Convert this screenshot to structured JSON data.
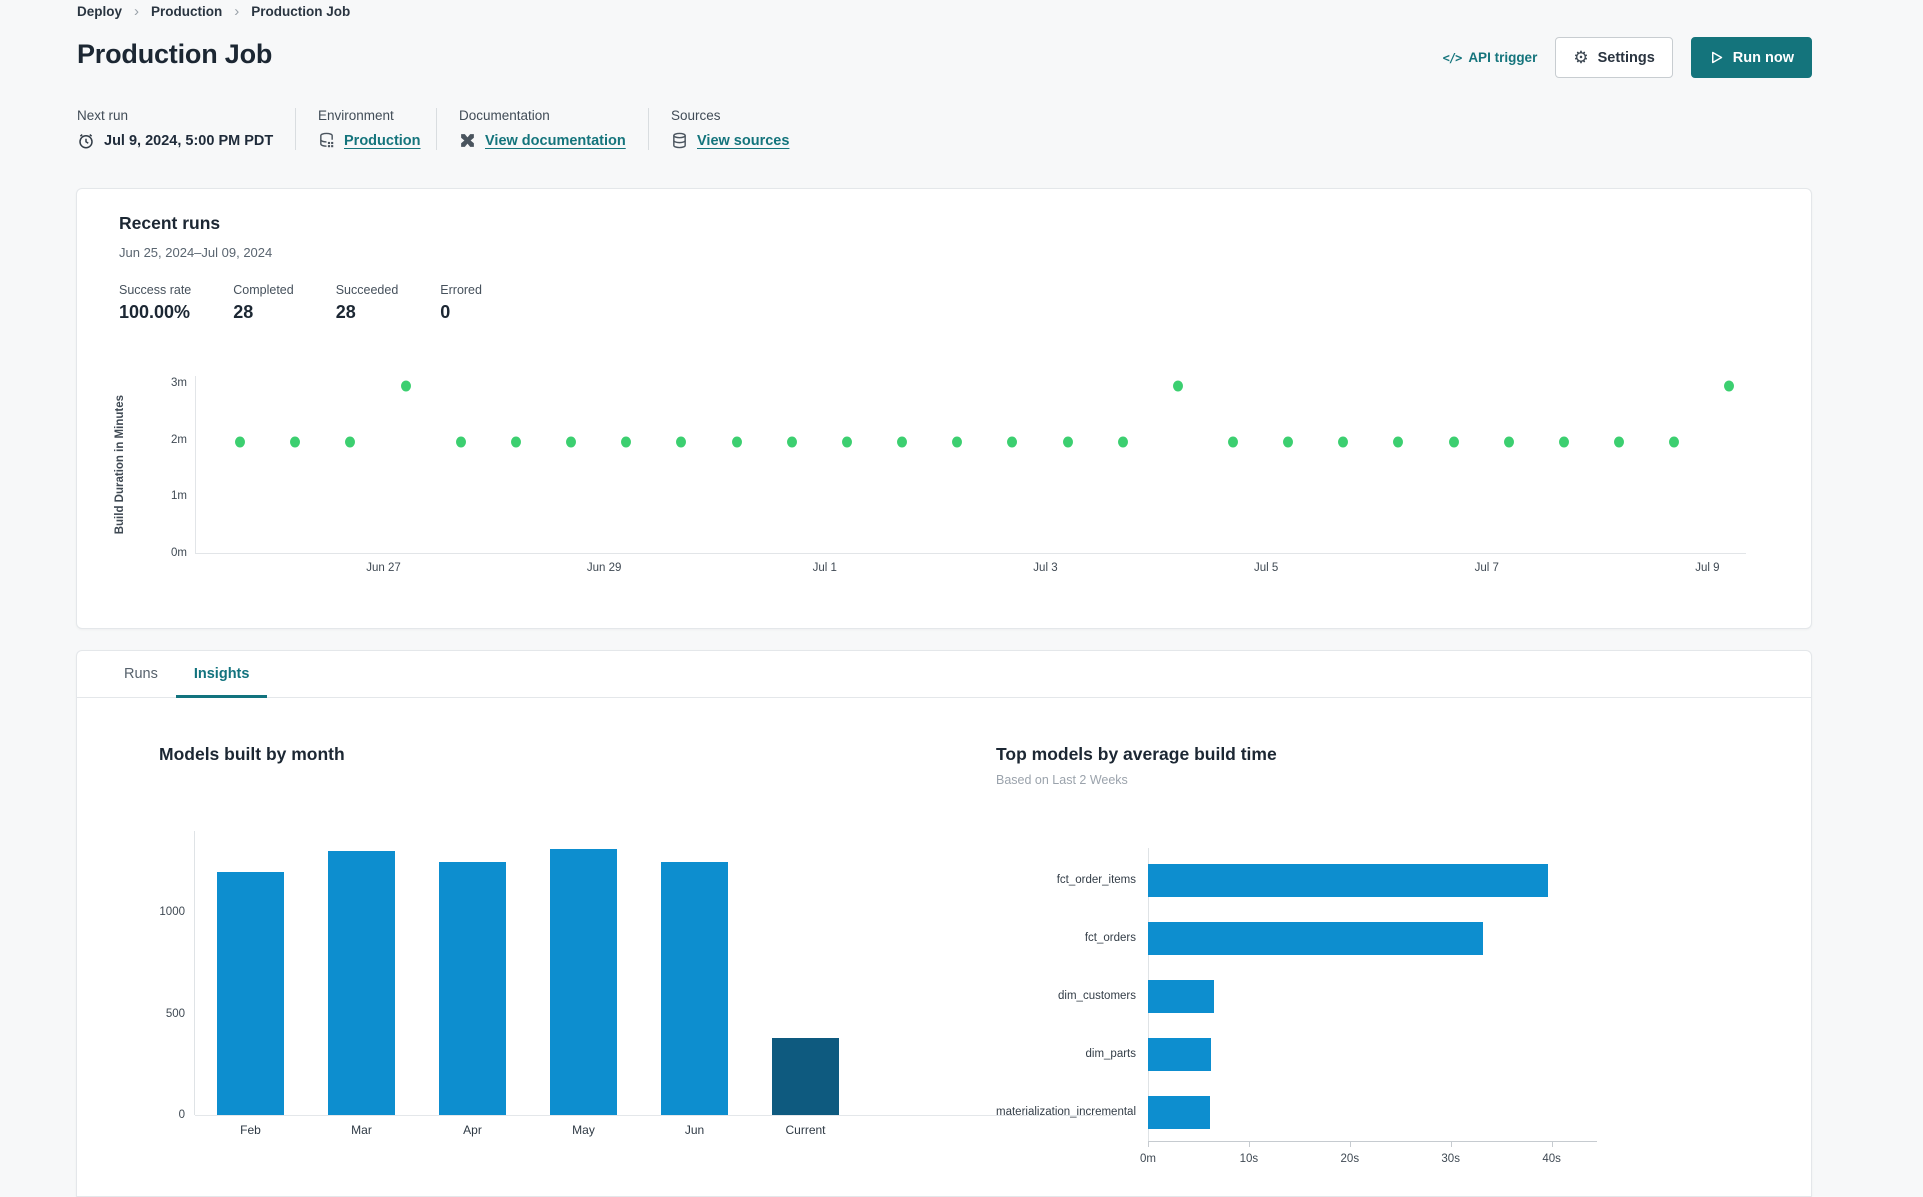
{
  "breadcrumb": {
    "items": [
      "Deploy",
      "Production",
      "Production Job"
    ]
  },
  "header": {
    "title": "Production Job",
    "api_trigger_label": "API trigger",
    "settings_label": "Settings",
    "run_now_label": "Run now"
  },
  "info": {
    "next_run": {
      "label": "Next run",
      "value": "Jul 9, 2024, 5:00 PM PDT"
    },
    "environment": {
      "label": "Environment",
      "link": "Production"
    },
    "documentation": {
      "label": "Documentation",
      "link": "View documentation"
    },
    "sources": {
      "label": "Sources",
      "link": "View sources"
    }
  },
  "recent_runs": {
    "title": "Recent runs",
    "date_range": "Jun 25, 2024–Jul 09, 2024",
    "stats": [
      {
        "label": "Success rate",
        "value": "100.00%"
      },
      {
        "label": "Completed",
        "value": "28"
      },
      {
        "label": "Succeeded",
        "value": "28"
      },
      {
        "label": "Errored",
        "value": "0"
      }
    ]
  },
  "tabs": [
    {
      "label": "Runs",
      "active": false
    },
    {
      "label": "Insights",
      "active": true
    }
  ],
  "colors": {
    "accent_teal": "#14747c",
    "bar_blue": "#0d8ecf",
    "bar_dark_blue": "#0e5a7f",
    "dot_green": "#3ccf70"
  },
  "chart_data": [
    {
      "id": "run-durations",
      "type": "scatter",
      "ylabel": "Build Duration in Minutes",
      "x_range": [
        -0.4,
        13.65
      ],
      "y_range": [
        0,
        3.12
      ],
      "y_ticks": [
        {
          "label": "3m",
          "minutes": 3
        },
        {
          "label": "2m",
          "minutes": 2
        },
        {
          "label": "1m",
          "minutes": 1
        },
        {
          "label": "0m",
          "minutes": 0
        }
      ],
      "x_ticks": [
        {
          "label": "Jun 27",
          "day": 1.3
        },
        {
          "label": "Jun 29",
          "day": 3.3
        },
        {
          "label": "Jul 1",
          "day": 5.3
        },
        {
          "label": "Jul 3",
          "day": 7.3
        },
        {
          "label": "Jul 5",
          "day": 9.3
        },
        {
          "label": "Jul 7",
          "day": 11.3
        },
        {
          "label": "Jul 9",
          "day": 13.3
        }
      ],
      "point_color": "#3ccf70",
      "points": [
        {
          "day": 0.0,
          "minutes": 1.95
        },
        {
          "day": 0.5,
          "minutes": 1.95
        },
        {
          "day": 1.0,
          "minutes": 1.95
        },
        {
          "day": 1.5,
          "minutes": 2.95
        },
        {
          "day": 2.0,
          "minutes": 1.95
        },
        {
          "day": 2.5,
          "minutes": 1.95
        },
        {
          "day": 3.0,
          "minutes": 1.95
        },
        {
          "day": 3.5,
          "minutes": 1.95
        },
        {
          "day": 4.0,
          "minutes": 1.95
        },
        {
          "day": 4.5,
          "minutes": 1.95
        },
        {
          "day": 5.0,
          "minutes": 1.95
        },
        {
          "day": 5.5,
          "minutes": 1.95
        },
        {
          "day": 6.0,
          "minutes": 1.95
        },
        {
          "day": 6.5,
          "minutes": 1.95
        },
        {
          "day": 7.0,
          "minutes": 1.95
        },
        {
          "day": 7.5,
          "minutes": 1.95
        },
        {
          "day": 8.0,
          "minutes": 1.95
        },
        {
          "day": 8.5,
          "minutes": 2.95
        },
        {
          "day": 9.0,
          "minutes": 1.95
        },
        {
          "day": 9.5,
          "minutes": 1.95
        },
        {
          "day": 10.0,
          "minutes": 1.95
        },
        {
          "day": 10.5,
          "minutes": 1.95
        },
        {
          "day": 11.0,
          "minutes": 1.95
        },
        {
          "day": 11.5,
          "minutes": 1.95
        },
        {
          "day": 12.0,
          "minutes": 1.95
        },
        {
          "day": 12.5,
          "minutes": 1.95
        },
        {
          "day": 13.0,
          "minutes": 1.95
        },
        {
          "day": 13.5,
          "minutes": 2.95
        }
      ]
    },
    {
      "id": "models-by-month",
      "type": "bar",
      "title": "Models built by month",
      "categories": [
        "Feb",
        "Mar",
        "Apr",
        "May",
        "Jun",
        "Current"
      ],
      "values": [
        1200,
        1300,
        1245,
        1310,
        1245,
        380
      ],
      "y_ticks": [
        0,
        500,
        1000
      ],
      "ylim": [
        0,
        1400
      ],
      "bar_color": "#0d8ecf",
      "current_bar_color": "#0e5a7f"
    },
    {
      "id": "top-models-by-build-time",
      "type": "bar-horizontal",
      "title": "Top models by average build time",
      "subtitle": "Based on Last 2 Weeks",
      "categories": [
        "fct_order_items",
        "fct_orders",
        "dim_customers",
        "dim_parts",
        "materialization_incremental"
      ],
      "values_seconds": [
        40,
        33.5,
        6.6,
        6.3,
        6.2
      ],
      "x_ticks": [
        {
          "label": "0m",
          "s": 0
        },
        {
          "label": "10s",
          "s": 10
        },
        {
          "label": "20s",
          "s": 20
        },
        {
          "label": "30s",
          "s": 30
        },
        {
          "label": "40s",
          "s": 40
        }
      ],
      "xlim": [
        0,
        44.5
      ],
      "bar_color": "#0d8ecf"
    }
  ]
}
